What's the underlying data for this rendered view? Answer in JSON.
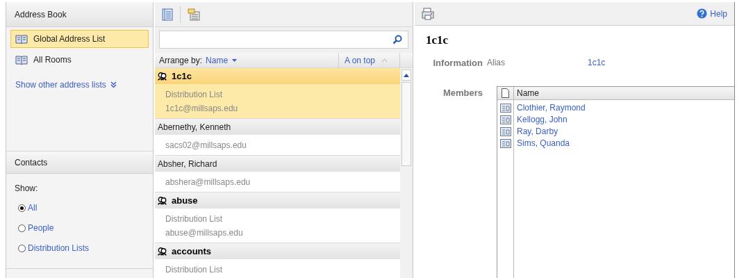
{
  "sidebar": {
    "title": "Address Book",
    "address_lists": [
      {
        "label": "Global Address List",
        "selected": true
      },
      {
        "label": "All Rooms",
        "selected": false
      }
    ],
    "more_link": "Show other address lists",
    "contacts": {
      "title": "Contacts",
      "show_label": "Show:",
      "filters": [
        {
          "label": "All",
          "selected": true
        },
        {
          "label": "People",
          "selected": false
        },
        {
          "label": "Distribution Lists",
          "selected": false
        }
      ]
    }
  },
  "list": {
    "arrange_label": "Arrange by:",
    "arrange_value": "Name",
    "sort": "A on top",
    "items": [
      {
        "kind": "group",
        "name": "1c1c",
        "selected": true,
        "lines": [
          "Distribution List",
          "1c1c@millsaps.edu"
        ]
      },
      {
        "kind": "person",
        "name": "Abernethy, Kenneth",
        "selected": false,
        "lines": [
          "sacs02@millsaps.edu"
        ]
      },
      {
        "kind": "person",
        "name": "Absher, Richard",
        "selected": false,
        "lines": [
          "abshera@millsaps.edu"
        ]
      },
      {
        "kind": "group",
        "name": "abuse",
        "selected": false,
        "lines": [
          "Distribution List",
          "abuse@millsaps.edu"
        ]
      },
      {
        "kind": "group",
        "name": "accounts",
        "selected": false,
        "lines": [
          "Distribution List"
        ]
      }
    ]
  },
  "detail": {
    "help": "Help",
    "title": "1c1c",
    "info_label": "Information",
    "alias_label": "Alias",
    "alias_value": "1c1c",
    "members_label": "Members",
    "members_column": "Name",
    "members": [
      "Clothier, Raymond",
      "Kellogg, John",
      "Ray, Darby",
      "Sims, Quanda"
    ]
  }
}
